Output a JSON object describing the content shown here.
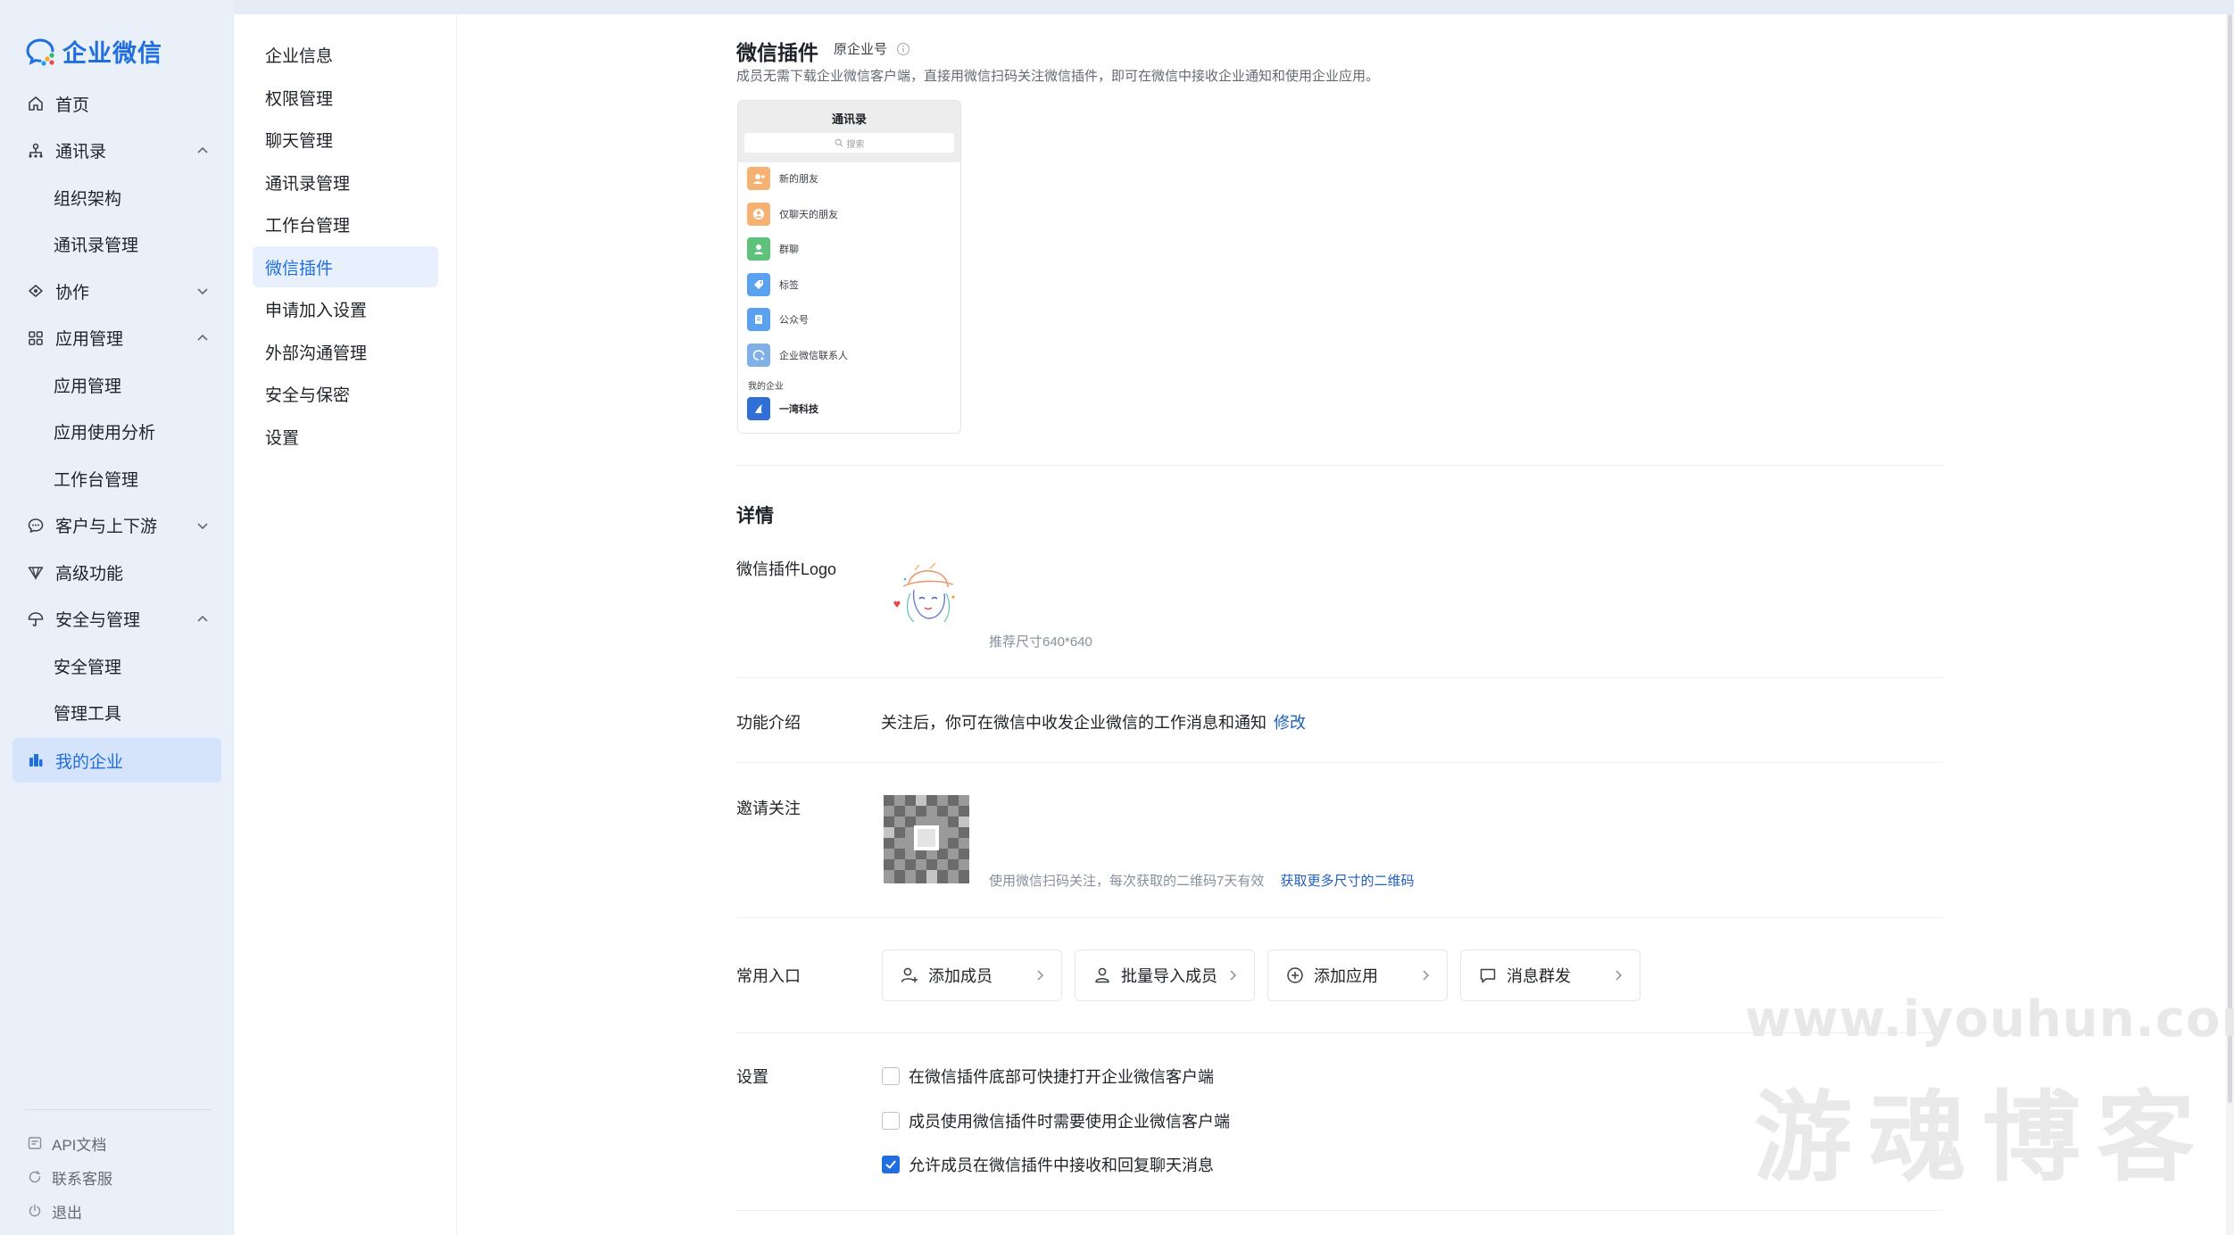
{
  "brand": {
    "name": "企业微信"
  },
  "nav": {
    "items": [
      {
        "label": "首页",
        "icon": "home-icon",
        "level": 0
      },
      {
        "label": "通讯录",
        "icon": "org-tree-icon",
        "level": 0,
        "expanded": true
      },
      {
        "label": "组织架构",
        "level": 1
      },
      {
        "label": "通讯录管理",
        "level": 1
      },
      {
        "label": "协作",
        "icon": "collab-icon",
        "level": 0,
        "expanded": false
      },
      {
        "label": "应用管理",
        "icon": "apps-grid-icon",
        "level": 0,
        "expanded": true
      },
      {
        "label": "应用管理",
        "level": 1
      },
      {
        "label": "应用使用分析",
        "level": 1
      },
      {
        "label": "工作台管理",
        "level": 1
      },
      {
        "label": "客户与上下游",
        "icon": "chat-bubble-icon",
        "level": 0,
        "expanded": false
      },
      {
        "label": "高级功能",
        "icon": "diamond-icon",
        "level": 0
      },
      {
        "label": "安全与管理",
        "icon": "umbrella-icon",
        "level": 0,
        "expanded": true
      },
      {
        "label": "安全管理",
        "level": 1
      },
      {
        "label": "管理工具",
        "level": 1
      },
      {
        "label": "我的企业",
        "icon": "building-icon",
        "level": 0,
        "active": true
      }
    ],
    "bottom": [
      {
        "label": "API文档",
        "icon": "api-doc-icon"
      },
      {
        "label": "联系客服",
        "icon": "support-icon"
      },
      {
        "label": "退出",
        "icon": "power-icon"
      }
    ]
  },
  "subnav": {
    "items": [
      {
        "label": "企业信息"
      },
      {
        "label": "权限管理"
      },
      {
        "label": "聊天管理"
      },
      {
        "label": "通讯录管理"
      },
      {
        "label": "工作台管理"
      },
      {
        "label": "微信插件",
        "active": true
      },
      {
        "label": "申请加入设置"
      },
      {
        "label": "外部沟通管理"
      },
      {
        "label": "安全与保密"
      },
      {
        "label": "设置"
      }
    ]
  },
  "main": {
    "title": "微信插件",
    "title_tag": "原企业号",
    "description": "成员无需下载企业微信客户端，直接用微信扫码关注微信插件，即可在微信中接收企业通知和使用企业应用。",
    "preview": {
      "title": "通讯录",
      "search_placeholder": "搜索",
      "rows": [
        {
          "label": "新的朋友",
          "color": "#f5b273"
        },
        {
          "label": "仅聊天的朋友",
          "color": "#f5b273"
        },
        {
          "label": "群聊",
          "color": "#5ec27a"
        },
        {
          "label": "标签",
          "color": "#5aa2f0"
        },
        {
          "label": "公众号",
          "color": "#5aa2f0"
        },
        {
          "label": "企业微信联系人",
          "color": "#7fb0e8"
        }
      ],
      "section_label": "我的企业",
      "company_name": "一湾科技"
    },
    "details_title": "详情",
    "logo": {
      "label": "微信插件Logo",
      "hint": "推荐尺寸640*640"
    },
    "func": {
      "label": "功能介绍",
      "text": "关注后，你可在微信中收发企业微信的工作消息和通知",
      "edit": "修改"
    },
    "invite": {
      "label": "邀请关注",
      "hint": "使用微信扫码关注，每次获取的二维码7天有效",
      "link": "获取更多尺寸的二维码"
    },
    "quick": {
      "label": "常用入口",
      "buttons": [
        {
          "label": "添加成员",
          "icon": "add-user-icon"
        },
        {
          "label": "批量导入成员",
          "icon": "import-users-icon"
        },
        {
          "label": "添加应用",
          "icon": "add-circle-icon"
        },
        {
          "label": "消息群发",
          "icon": "message-icon"
        }
      ]
    },
    "settings": {
      "label": "设置",
      "options": [
        {
          "label": "在微信插件底部可快捷打开企业微信客户端",
          "checked": false
        },
        {
          "label": "成员使用微信插件时需要使用企业微信客户端",
          "checked": false
        },
        {
          "label": "允许成员在微信插件中接收和回复聊天消息",
          "checked": true
        }
      ]
    }
  },
  "watermark": {
    "url": "www.iyouhun.com",
    "text": "游魂博客"
  },
  "colors": {
    "accent": "#1f6fe0",
    "link": "#1f5fbf",
    "nav_bg": "#eaf0f9",
    "active_bg": "#d5e4fb"
  }
}
